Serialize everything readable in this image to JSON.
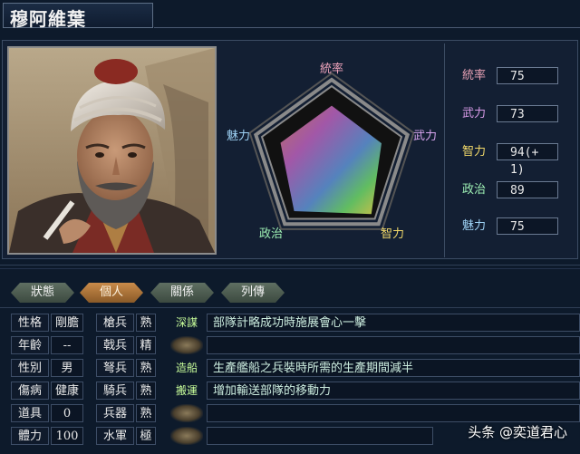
{
  "general": {
    "name": "穆阿維葉"
  },
  "radar": {
    "labels": {
      "tongshuai": "統率",
      "wuli": "武力",
      "zhili": "智力",
      "zhengzhi": "政治",
      "meili": "魅力"
    },
    "values": [
      75,
      73,
      94,
      89,
      75
    ],
    "max": 100
  },
  "stats": [
    {
      "label": "統率",
      "value": "75",
      "color": "#e6a0b4"
    },
    {
      "label": "武力",
      "value": "73",
      "color": "#d89be8"
    },
    {
      "label": "智力",
      "value": "94(+ 1)",
      "color": "#f2d96a"
    },
    {
      "label": "政治",
      "value": "89",
      "color": "#9ef0b4"
    },
    {
      "label": "魅力",
      "value": "75",
      "color": "#9ed2f5"
    }
  ],
  "tabs": [
    "狀態",
    "個人",
    "關係",
    "列傳"
  ],
  "active_tab": "個人",
  "personal": [
    {
      "label": "性格",
      "value": "剛膽"
    },
    {
      "label": "年齡",
      "value": "--"
    },
    {
      "label": "性別",
      "value": "男"
    },
    {
      "label": "傷病",
      "value": "健康"
    },
    {
      "label": "道具",
      "value": "0"
    },
    {
      "label": "體力",
      "value": "100"
    }
  ],
  "aptitudes": [
    {
      "label": "槍兵",
      "value": "熟"
    },
    {
      "label": "戟兵",
      "value": "精"
    },
    {
      "label": "弩兵",
      "value": "熟"
    },
    {
      "label": "騎兵",
      "value": "熟"
    },
    {
      "label": "兵器",
      "value": "熟"
    },
    {
      "label": "水軍",
      "value": "極"
    }
  ],
  "skills": [
    {
      "name": "深謀",
      "desc": "部隊計略成功時施展會心一擊"
    },
    {
      "name": "",
      "desc": ""
    },
    {
      "name": "造船",
      "desc": "生產艦船之兵裝時所需的生產期間減半"
    },
    {
      "name": "搬運",
      "desc": "增加輸送部隊的移動力"
    },
    {
      "name": "",
      "desc": ""
    },
    {
      "name": "",
      "desc": ""
    }
  ],
  "watermark": "头条 @奕道君心",
  "colors": {
    "accent_active_tab": "#c98b4a",
    "skill_name": "#c9ff9b"
  }
}
